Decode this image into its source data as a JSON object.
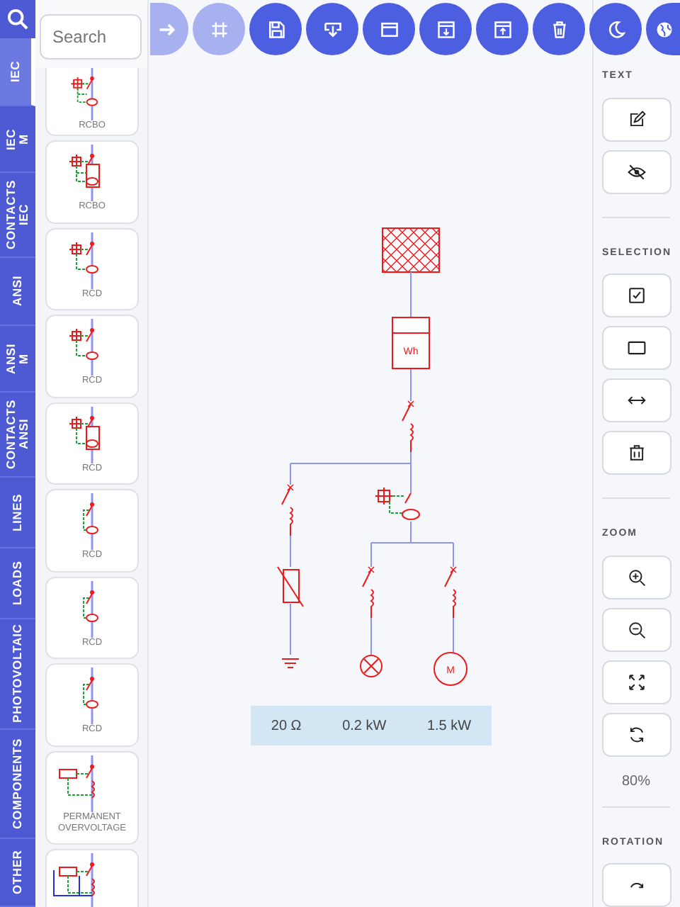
{
  "sidebar_tabs": [
    {
      "label": "IEC",
      "selected": true
    },
    {
      "label": "IEC M",
      "selected": false
    },
    {
      "label": "CONTACTS IEC",
      "selected": false
    },
    {
      "label": "ANSI",
      "selected": false
    },
    {
      "label": "ANSI M",
      "selected": false
    },
    {
      "label": "CONTACTS ANSI",
      "selected": false
    },
    {
      "label": "LINES",
      "selected": false
    },
    {
      "label": "LOADS",
      "selected": false
    },
    {
      "label": "PHOTOVOLTAIC",
      "selected": false
    },
    {
      "label": "COMPONENTS",
      "selected": false
    },
    {
      "label": "OTHER",
      "selected": false
    }
  ],
  "search": {
    "placeholder": "Search"
  },
  "components": [
    {
      "label": "RCBO",
      "kind": "rcbo"
    },
    {
      "label": "RCBO",
      "kind": "rcbo-box"
    },
    {
      "label": "RCD",
      "kind": "rcd"
    },
    {
      "label": "RCD",
      "kind": "rcd"
    },
    {
      "label": "RCD",
      "kind": "rcd-box"
    },
    {
      "label": "RCD",
      "kind": "rcd-plain"
    },
    {
      "label": "RCD",
      "kind": "rcd-plain"
    },
    {
      "label": "RCD",
      "kind": "rcd-plain"
    },
    {
      "label": "PERMANENT OVERVOLTAGE",
      "kind": "overvoltage"
    },
    {
      "kind": "overvoltage-bus"
    }
  ],
  "toolbar": [
    {
      "disabled": true
    },
    {
      "disabled": true
    },
    {
      "disabled": false
    },
    {
      "disabled": false
    },
    {
      "disabled": false
    },
    {
      "disabled": false
    },
    {
      "disabled": false
    },
    {
      "disabled": false
    },
    {
      "disabled": false
    },
    {
      "disabled": false
    }
  ],
  "diagram": {
    "meter_label": "Wh",
    "motor_label": "M",
    "readings": [
      "20 Ω",
      "0.2 kW",
      "1.5 kW"
    ]
  },
  "tool_sections": [
    {
      "title": "TEXT"
    },
    {
      "title": "SELECTION"
    },
    {
      "title": "ZOOM",
      "zoom_level": "80%"
    },
    {
      "title": "ROTATION"
    }
  ]
}
